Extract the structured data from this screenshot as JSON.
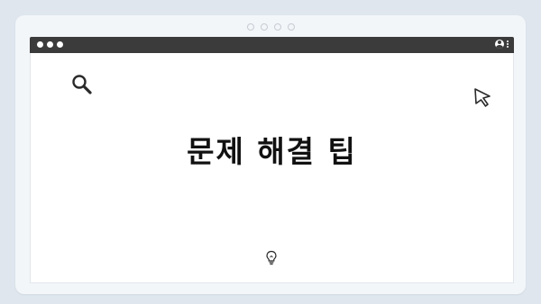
{
  "slide": {
    "headline": "문제 해결 팁",
    "pager_count": 4
  },
  "window": {
    "traffic_dots": 3,
    "right_icons": [
      "user-icon",
      "kebab-menu-icon"
    ]
  },
  "icons": {
    "top_left": "search-icon",
    "top_right": "cursor-icon",
    "bottom": "lightbulb-icon"
  },
  "colors": {
    "page_background": "#dfe6ee",
    "card_background": "#f3f6f9",
    "titlebar": "#3b3b3b",
    "content_background": "#ffffff",
    "headline_text": "#111111"
  }
}
